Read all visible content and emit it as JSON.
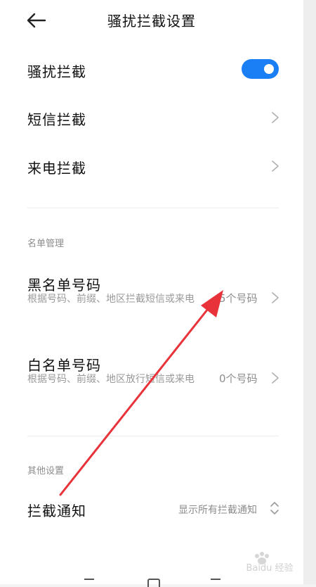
{
  "header": {
    "title": "骚扰拦截设置"
  },
  "settings": {
    "harassment_block": {
      "label": "骚扰拦截",
      "enabled": true
    },
    "sms_block": {
      "label": "短信拦截"
    },
    "call_block": {
      "label": "来电拦截"
    }
  },
  "list_management": {
    "section_title": "名单管理",
    "blacklist": {
      "label": "黑名单号码",
      "description": "根据号码、前缀、地区拦截短信或来电",
      "count": "5个号码"
    },
    "whitelist": {
      "label": "白名单号码",
      "description": "根据号码、前缀、地区放行短信或来电",
      "count": "0个号码"
    }
  },
  "other_settings": {
    "section_title": "其他设置",
    "notification": {
      "label": "拦截通知",
      "value": "显示所有拦截通知"
    }
  },
  "watermark": {
    "text": "Baidu 经验"
  },
  "colors": {
    "accent": "#1a7ff5",
    "annotation_arrow": "#e8333a"
  }
}
